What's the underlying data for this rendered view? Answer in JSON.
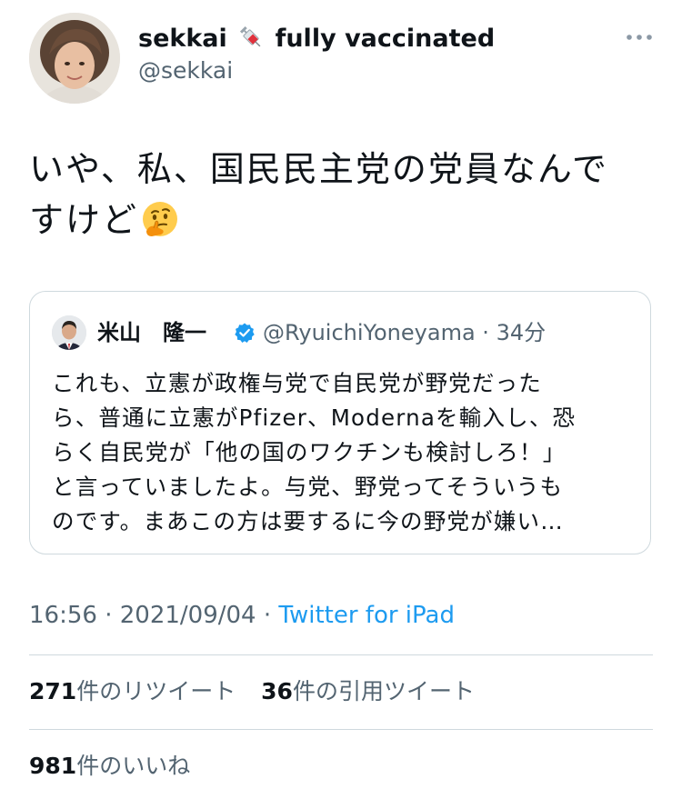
{
  "tweet": {
    "author": {
      "display_name": "sekkai",
      "display_name_suffix": "fully vaccinated",
      "handle": "@sekkai"
    },
    "text_line1": "いや、私、国民民主党の党員なんで",
    "text_line2": "すけど",
    "quote": {
      "author_name": "米山　隆一",
      "handle": "@RyuichiYoneyama",
      "separator": "·",
      "time": "34分",
      "lines": [
        "これも、立憲が政権与党で自民党が野党だった",
        "ら、普通に立憲がPfizer、Modernaを輸入し、恐",
        "らく自民党が「他の国のワクチンも検討しろ！」",
        "と言っていましたよ。与党、野党ってそういうも",
        "のです。まあこの方は要するに今の野党が嫌い…"
      ]
    },
    "time": "16:56",
    "separator1": "·",
    "date": "2021/09/04",
    "separator2": "·",
    "client": "Twitter for iPad",
    "retweets": {
      "count": "271",
      "label": "件のリツイート"
    },
    "quote_tweets": {
      "count": "36",
      "label": "件の引用ツイート"
    },
    "likes": {
      "count": "981",
      "label": "件のいいね"
    }
  },
  "colors": {
    "text": "#0f1419",
    "secondary": "#536471",
    "link": "#1d9bf0",
    "border": "#cfd9de"
  },
  "icons": [
    "avatar-photo",
    "syringe-emoji",
    "more-icon",
    "thinking-face-emoji",
    "verified-badge-icon"
  ]
}
